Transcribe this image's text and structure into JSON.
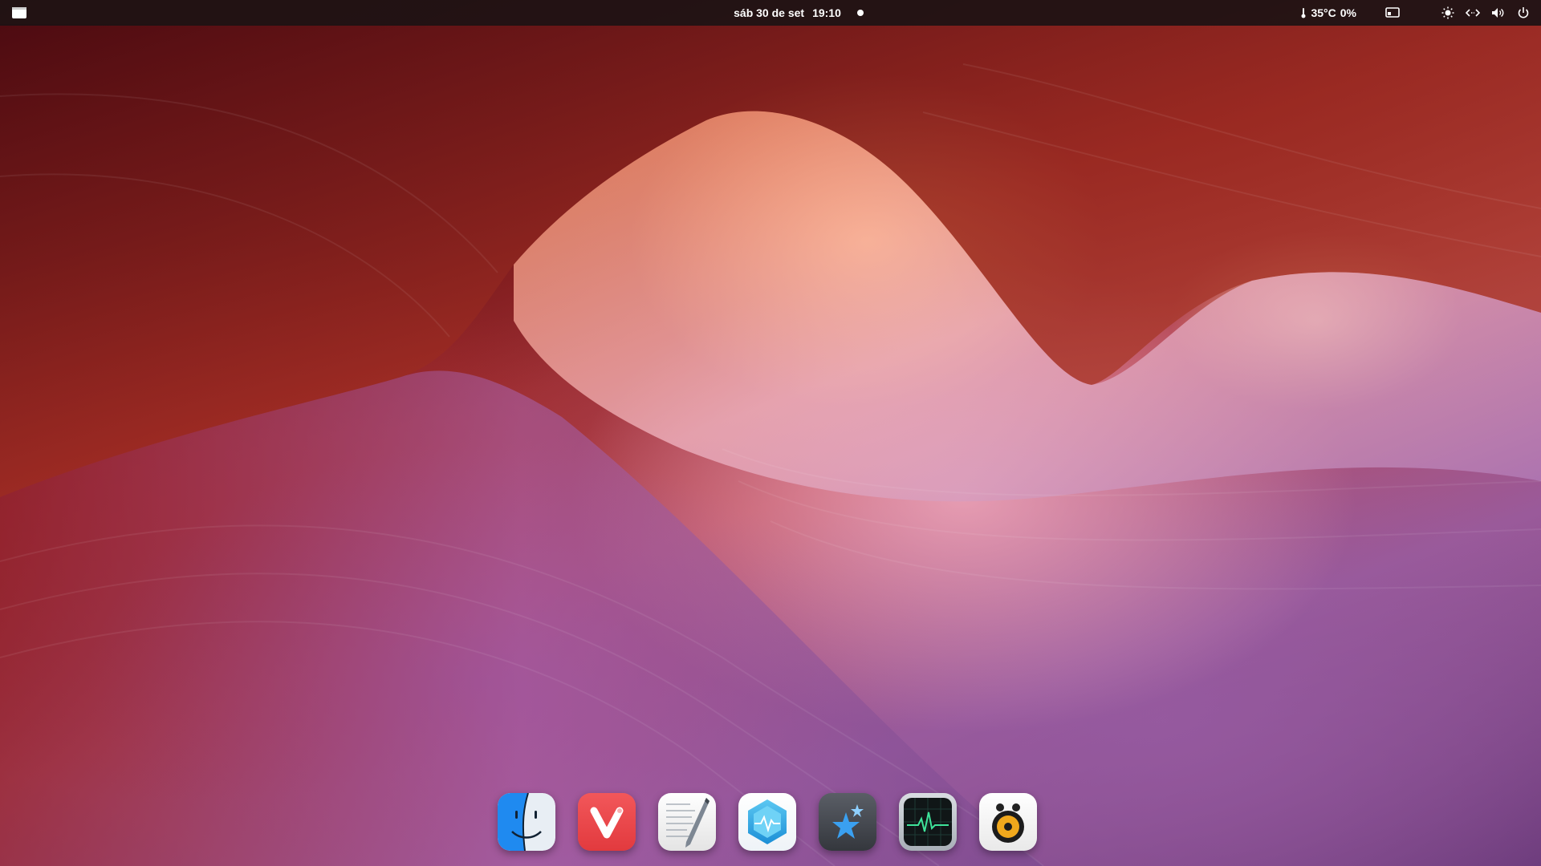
{
  "topbar": {
    "date": "sáb 30 de set",
    "time": "19:10",
    "weather": "35°C",
    "battery": "0%"
  },
  "icons": {
    "activities": "window-icon",
    "temperature": "thermometer-icon",
    "screen": "display-icon",
    "brightness": "brightness-icon",
    "network": "network-icon",
    "volume": "volume-icon",
    "power": "power-icon"
  },
  "dock": {
    "apps": [
      {
        "name": "finder",
        "icon": "finder-icon"
      },
      {
        "name": "vivaldi",
        "icon": "vivaldi-icon"
      },
      {
        "name": "text-editor",
        "icon": "text-editor-icon"
      },
      {
        "name": "system-monitor",
        "icon": "hexagon-pulse-icon"
      },
      {
        "name": "app-store",
        "icon": "star-icon"
      },
      {
        "name": "activity-monitor",
        "icon": "heartbeat-icon"
      },
      {
        "name": "speaker",
        "icon": "speaker-icon"
      }
    ]
  },
  "colors": {
    "topbar_bg": "#1c1214",
    "topbar_text": "#ffffff"
  }
}
